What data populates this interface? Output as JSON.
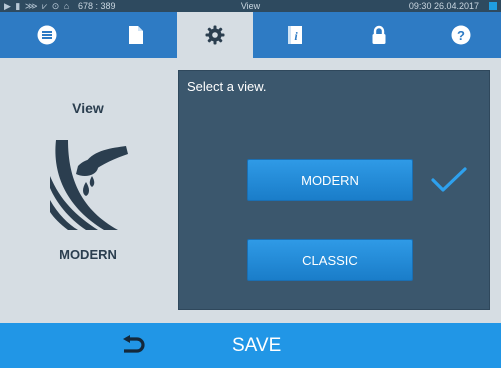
{
  "status_bar": {
    "coords": "678 : 389",
    "title": "View",
    "clock": "09:30 26.04.2017"
  },
  "tabs": [
    {
      "name": "menu",
      "icon": "list-icon"
    },
    {
      "name": "document",
      "icon": "document-icon"
    },
    {
      "name": "settings",
      "icon": "gear-icon",
      "active": true
    },
    {
      "name": "info",
      "icon": "info-book-icon"
    },
    {
      "name": "lock",
      "icon": "lock-icon"
    },
    {
      "name": "help",
      "icon": "help-icon"
    }
  ],
  "side": {
    "label": "View",
    "current_value": "MODERN"
  },
  "panel": {
    "prompt": "Select a view.",
    "options": [
      {
        "label": "MODERN",
        "selected": true
      },
      {
        "label": "CLASSIC",
        "selected": false
      }
    ]
  },
  "bottom": {
    "save_label": "SAVE"
  },
  "colors": {
    "accent": "#2196e6",
    "panel": "#3b576d",
    "tabbar": "#2e7bc4"
  }
}
